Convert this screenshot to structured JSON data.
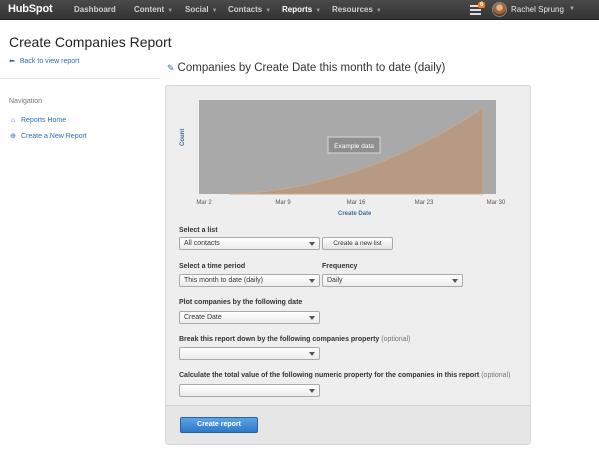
{
  "nav": {
    "logo": "HubSpot",
    "items": [
      {
        "label": "Dashboard",
        "has_caret": false
      },
      {
        "label": "Content",
        "has_caret": true
      },
      {
        "label": "Social",
        "has_caret": true
      },
      {
        "label": "Contacts",
        "has_caret": true
      },
      {
        "label": "Reports",
        "has_caret": true
      },
      {
        "label": "Resources",
        "has_caret": true
      }
    ],
    "active": "Reports",
    "notification_count": "6",
    "user_name": "Rachel Sprung"
  },
  "page": {
    "title": "Create Companies Report",
    "back_link": "Back to view report"
  },
  "sidebar": {
    "heading": "Navigation",
    "links": [
      {
        "label": "Reports Home",
        "icon": "house-icon"
      },
      {
        "label": "Create a New Report",
        "icon": "plus-circle-icon"
      }
    ]
  },
  "report": {
    "title": "Companies by Create Date this month to date (daily)"
  },
  "chart_data": {
    "type": "area",
    "ylabel": "Count",
    "xlabel": "Create Date",
    "x_ticks": [
      "Mar 2",
      "Mar 9",
      "Mar 16",
      "Mar 23",
      "Mar 30"
    ],
    "overlay_label": "Example data",
    "series": [
      {
        "values": [
          0,
          0.01,
          0.03,
          0.06,
          0.1,
          0.15,
          0.21,
          0.28,
          0.36,
          0.45,
          0.55,
          0.66,
          0.78,
          0.92
        ]
      }
    ],
    "colors": {
      "background": "#a9a9a9",
      "area": "#b79a84",
      "line": "#c9a88e"
    }
  },
  "form": {
    "list_label": "Select a list",
    "list_value": "All contacts",
    "new_list_button": "Create a new list",
    "period_label": "Select a time period",
    "period_value": "This month to date (daily)",
    "frequency_label": "Frequency",
    "frequency_value": "Daily",
    "plot_label": "Plot companies by the following date",
    "plot_value": "Create Date",
    "breakdown_label": "Break this report down by the following companies property",
    "breakdown_optional": "(optional)",
    "breakdown_value": "",
    "total_label": "Calculate the total value of the following numeric property for the companies in this report",
    "total_optional": "(optional)",
    "total_value": "",
    "submit_button": "Create report"
  },
  "colors": {
    "accent": "#2a6ebb",
    "brand_orange": "#f47b20",
    "primary_button": "#3a86d6"
  }
}
